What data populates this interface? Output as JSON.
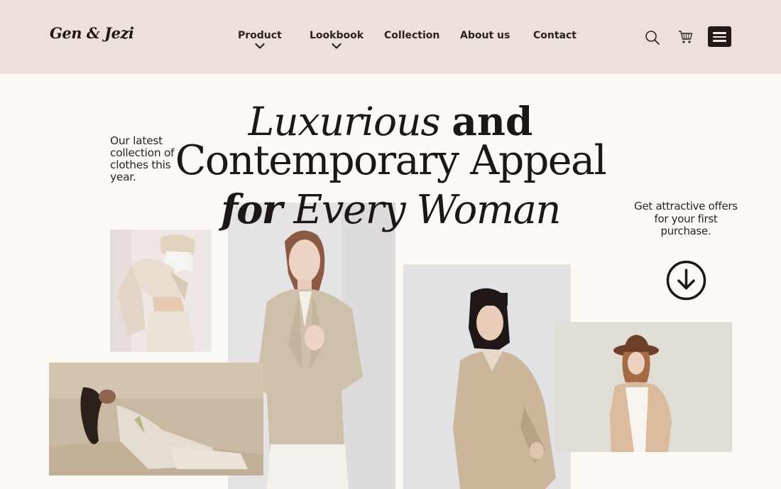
{
  "brand": {
    "logo": "Gen & Jezi"
  },
  "nav": {
    "items": [
      {
        "label": "Product",
        "has_dropdown": true
      },
      {
        "label": "Lookbook",
        "has_dropdown": true
      },
      {
        "label": "Collection",
        "has_dropdown": false
      },
      {
        "label": "About us",
        "has_dropdown": false
      },
      {
        "label": "Contact",
        "has_dropdown": false
      }
    ],
    "icons": [
      "search-icon",
      "cart-icon",
      "menu-icon"
    ]
  },
  "hero": {
    "line1_italic": "Luxurious ",
    "line1_bold": "and",
    "line2": "Contemporary Appeal",
    "line3_bold_italic": "for ",
    "line3_italic": "Every Woman",
    "left_note": "Our latest collection of clothes this year.",
    "right_note": "Get attractive offers for your first purchase."
  },
  "colors": {
    "header_bg": "#ece0dc",
    "page_bg": "#fdfaf6",
    "text_dark": "#1d1614",
    "accent_dark": "#231a18"
  },
  "photos": [
    {
      "name": "photo-woman-bucket-hat"
    },
    {
      "name": "photo-woman-blazer-center"
    },
    {
      "name": "photo-woman-desert"
    },
    {
      "name": "photo-woman-trench-coat"
    },
    {
      "name": "photo-woman-fedora"
    }
  ]
}
